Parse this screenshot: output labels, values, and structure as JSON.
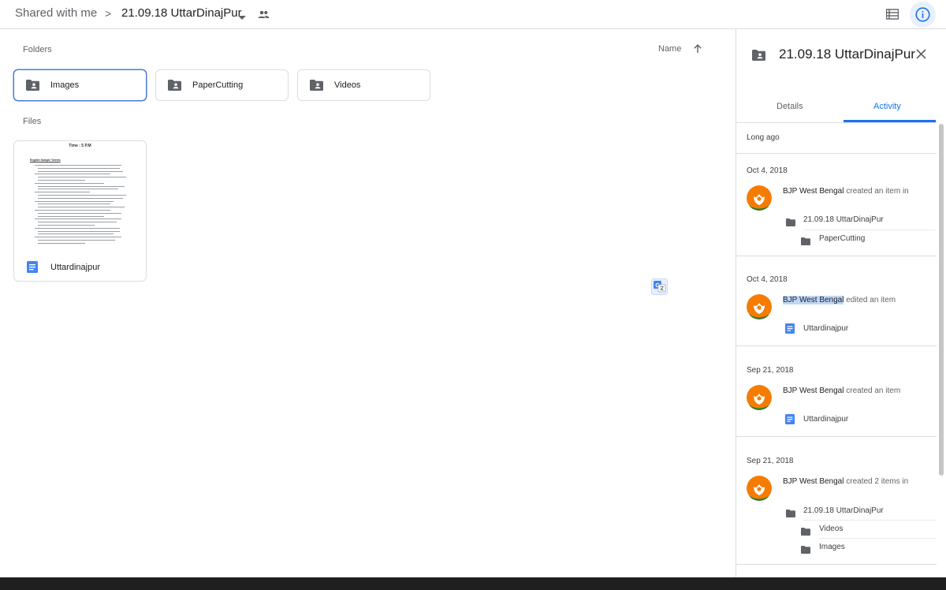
{
  "breadcrumb": {
    "root": "Shared with me",
    "separator": ">",
    "current": "21.09.18 UttarDinajPur"
  },
  "main": {
    "folders_label": "Folders",
    "files_label": "Files",
    "sort": {
      "label": "Name",
      "direction": "ascending"
    },
    "folders": [
      {
        "name": "Images",
        "selected": true
      },
      {
        "name": "PaperCutting",
        "selected": false
      },
      {
        "name": "Videos",
        "selected": false
      }
    ],
    "files": [
      {
        "name": "Uttardinajpur",
        "thumb_title": "Time : 5 P.M",
        "thumb_subtitle": "English Sample Tweets"
      }
    ]
  },
  "panel": {
    "title": "21.09.18 UttarDinajPur",
    "tabs": [
      {
        "label": "Details",
        "active": false
      },
      {
        "label": "Activity",
        "active": true
      }
    ],
    "section": "Long ago",
    "activities": [
      {
        "date": "Oct 4, 2018",
        "actor": "BJP West Bengal",
        "action": "created an item in",
        "items": [
          {
            "name": "21.09.18 UttarDinajPur",
            "kind": "folder"
          },
          {
            "name": "PaperCutting",
            "kind": "folder"
          }
        ]
      },
      {
        "date": "Oct 4, 2018",
        "actor": "BJP West Bengal",
        "action": "edited an item",
        "items": [
          {
            "name": "Uttardinajpur",
            "kind": "doc"
          }
        ]
      },
      {
        "date": "Sep 21, 2018",
        "actor": "BJP West Bengal",
        "action": "created an item",
        "items": [
          {
            "name": "Uttardinajpur",
            "kind": "doc"
          }
        ]
      },
      {
        "date": "Sep 21, 2018",
        "actor": "BJP West Bengal",
        "action": "created 2 items in",
        "items": [
          {
            "name": "21.09.18 UttarDinajPur",
            "kind": "folder"
          },
          {
            "name": "Videos",
            "kind": "folder"
          },
          {
            "name": "Images",
            "kind": "folder"
          }
        ]
      }
    ]
  },
  "colors": {
    "accent": "#1a73e8",
    "selected_border": "#4a7bd6",
    "avatar_orange": "#f57c00",
    "avatar_green": "#2e7d32"
  }
}
